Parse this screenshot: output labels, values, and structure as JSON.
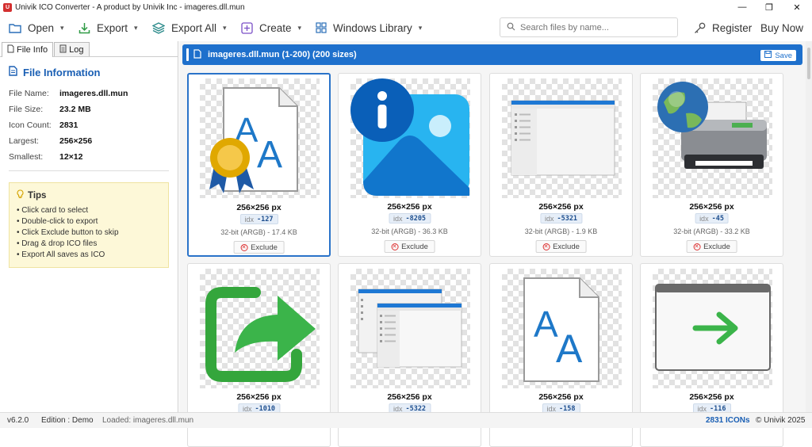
{
  "window": {
    "title": "Univik ICO Converter - A product by Univik Inc - imageres.dll.mun",
    "minimize_glyph": "—",
    "maximize_glyph": "❐",
    "close_glyph": "✕"
  },
  "toolbar": {
    "open": "Open",
    "export": "Export",
    "export_all": "Export All",
    "create": "Create",
    "windows_library": "Windows Library",
    "search_placeholder": "Search files by name...",
    "register": "Register",
    "buy_now": "Buy Now"
  },
  "left_panel": {
    "tabs": [
      "File Info",
      "Log"
    ],
    "title": "File Information",
    "rows": [
      {
        "key": "File Name:",
        "value": "imageres.dll.mun"
      },
      {
        "key": "File Size:",
        "value": "23.2 MB"
      },
      {
        "key": "Icon Count:",
        "value": "2831"
      },
      {
        "key": "Largest:",
        "value": "256×256"
      },
      {
        "key": "Smallest:",
        "value": "12×12"
      }
    ],
    "tips_title": "Tips",
    "tips": [
      "• Click card to select",
      "• Double-click to export",
      "• Click Exclude button to skip",
      "• Drag & drop ICO files",
      "• Export All saves as ICO"
    ]
  },
  "header": {
    "title": "imageres.dll.mun (1-200) (200 sizes)",
    "save": "Save"
  },
  "cards": [
    {
      "size": "256×256 px",
      "idx_label": "idx",
      "idx": "-127",
      "bits": "32-bit (ARGB) - 17.4 KB",
      "exclude": "Exclude",
      "icon": "font-certificate-icon"
    },
    {
      "size": "256×256 px",
      "idx_label": "idx",
      "idx": "-8205",
      "bits": "32-bit (ARGB) - 36.3 KB",
      "exclude": "Exclude",
      "icon": "image-info-icon"
    },
    {
      "size": "256×256 px",
      "idx_label": "idx",
      "idx": "-5321",
      "bits": "32-bit (ARGB) - 1.9 KB",
      "exclude": "Exclude",
      "icon": "window-list-icon"
    },
    {
      "size": "256×256 px",
      "idx_label": "idx",
      "idx": "-45",
      "bits": "32-bit (ARGB) - 33.2 KB",
      "exclude": "Exclude",
      "icon": "network-printer-icon"
    },
    {
      "size": "256×256 px",
      "idx_label": "idx",
      "idx": "-1010",
      "icon": "share-arrow-icon"
    },
    {
      "size": "256×256 px",
      "idx_label": "idx",
      "idx": "-5322",
      "icon": "cascade-windows-icon"
    },
    {
      "size": "256×256 px",
      "idx_label": "idx",
      "idx": "-158",
      "icon": "font-file-icon"
    },
    {
      "size": "256×256 px",
      "idx_label": "idx",
      "idx": "-116",
      "icon": "window-arrow-icon"
    }
  ],
  "status": {
    "version": "v6.2.0",
    "edition": "Edition : Demo",
    "loaded": "Loaded: imageres.dll.mun",
    "icon_count": "2831 ICONs",
    "copyright": "© Univik 2025"
  },
  "colors": {
    "accent": "#1e70cc",
    "tips_bg": "#fdf8d8",
    "title_blue": "#1a5fb4"
  }
}
